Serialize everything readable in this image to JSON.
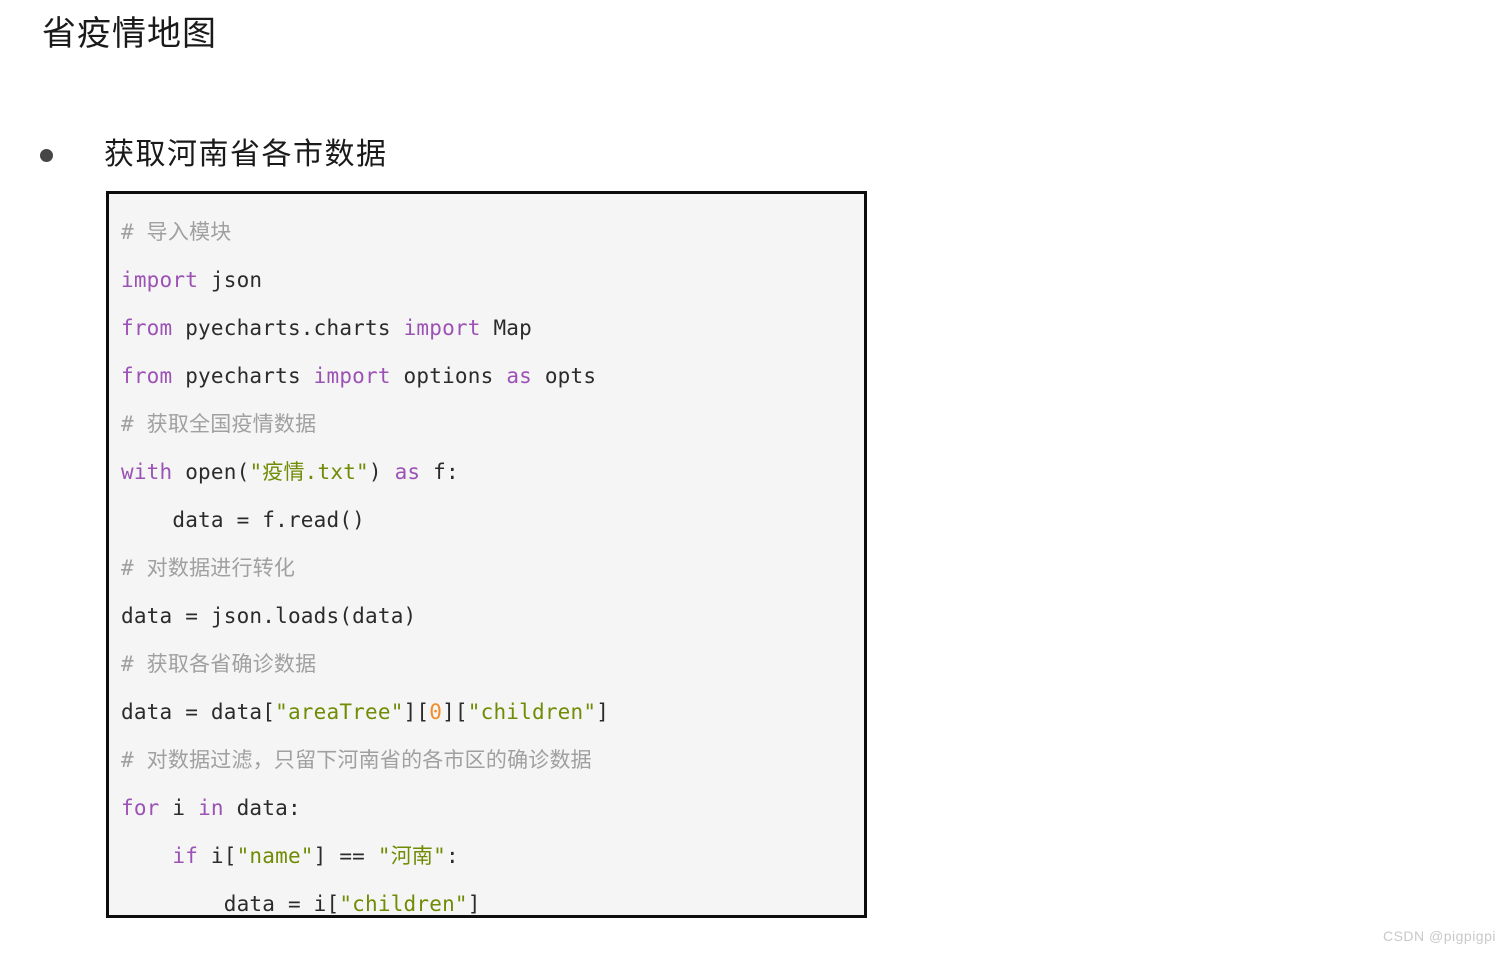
{
  "page": {
    "title": "省疫情地图",
    "background_color": "#ffffff"
  },
  "bullet": {
    "marker_icon": "filled-circle-bullet-icon",
    "marker_color": "#464646",
    "text": "获取河南省各市数据"
  },
  "code_block": {
    "background_color": "#f5f5f5",
    "border_color": "#0d0d0d",
    "language": "python",
    "syntax_colors": {
      "comment": "#a0a0a0",
      "keyword": "#9c52b5",
      "string": "#6f8c05",
      "number": "#f28c28",
      "plain": "#2b2b2b"
    },
    "lines": [
      {
        "index": 1,
        "text": "# 导入模块",
        "tokens": [
          {
            "t": "# 导入模块",
            "c": "comment"
          }
        ]
      },
      {
        "index": 2,
        "text": "import json",
        "tokens": [
          {
            "t": "import",
            "c": "kw"
          },
          {
            "t": " json",
            "c": "plain"
          }
        ]
      },
      {
        "index": 3,
        "text": "from pyecharts.charts import Map",
        "tokens": [
          {
            "t": "from",
            "c": "kw"
          },
          {
            "t": " pyecharts.charts ",
            "c": "plain"
          },
          {
            "t": "import",
            "c": "kw"
          },
          {
            "t": " Map",
            "c": "plain"
          }
        ]
      },
      {
        "index": 4,
        "text": "from pyecharts import options as opts",
        "tokens": [
          {
            "t": "from",
            "c": "kw"
          },
          {
            "t": " pyecharts ",
            "c": "plain"
          },
          {
            "t": "import",
            "c": "kw"
          },
          {
            "t": " options ",
            "c": "plain"
          },
          {
            "t": "as",
            "c": "kw"
          },
          {
            "t": " opts",
            "c": "plain"
          }
        ]
      },
      {
        "index": 5,
        "text": "# 获取全国疫情数据",
        "tokens": [
          {
            "t": "# 获取全国疫情数据",
            "c": "comment"
          }
        ]
      },
      {
        "index": 6,
        "text": "with open(\"疫情.txt\") as f:",
        "tokens": [
          {
            "t": "with",
            "c": "kw"
          },
          {
            "t": " open(",
            "c": "plain"
          },
          {
            "t": "\"疫情.txt\"",
            "c": "str"
          },
          {
            "t": ") ",
            "c": "plain"
          },
          {
            "t": "as",
            "c": "kw"
          },
          {
            "t": " f:",
            "c": "plain"
          }
        ]
      },
      {
        "index": 7,
        "text": "    data = f.read()",
        "tokens": [
          {
            "t": "    data = f.read()",
            "c": "plain"
          }
        ]
      },
      {
        "index": 8,
        "text": "# 对数据进行转化",
        "tokens": [
          {
            "t": "# 对数据进行转化",
            "c": "comment"
          }
        ]
      },
      {
        "index": 9,
        "text": "data = json.loads(data)",
        "tokens": [
          {
            "t": "data = json.loads(data)",
            "c": "plain"
          }
        ]
      },
      {
        "index": 10,
        "text": "# 获取各省确诊数据",
        "tokens": [
          {
            "t": "# 获取各省确诊数据",
            "c": "comment"
          }
        ]
      },
      {
        "index": 11,
        "text": "data = data[\"areaTree\"][0][\"children\"]",
        "tokens": [
          {
            "t": "data = data[",
            "c": "plain"
          },
          {
            "t": "\"areaTree\"",
            "c": "str"
          },
          {
            "t": "][",
            "c": "plain"
          },
          {
            "t": "0",
            "c": "num"
          },
          {
            "t": "][",
            "c": "plain"
          },
          {
            "t": "\"children\"",
            "c": "str"
          },
          {
            "t": "]",
            "c": "plain"
          }
        ]
      },
      {
        "index": 12,
        "text": "# 对数据过滤，只留下河南省的各市区的确诊数据",
        "tokens": [
          {
            "t": "# 对数据过滤，只留下河南省的各市区的确诊数据",
            "c": "comment"
          }
        ]
      },
      {
        "index": 13,
        "text": "for i in data:",
        "tokens": [
          {
            "t": "for",
            "c": "kw"
          },
          {
            "t": " i ",
            "c": "plain"
          },
          {
            "t": "in",
            "c": "kw"
          },
          {
            "t": " data:",
            "c": "plain"
          }
        ]
      },
      {
        "index": 14,
        "text": "    if i[\"name\"] == \"河南\":",
        "tokens": [
          {
            "t": "    ",
            "c": "plain"
          },
          {
            "t": "if",
            "c": "kw"
          },
          {
            "t": " i[",
            "c": "plain"
          },
          {
            "t": "\"name\"",
            "c": "str"
          },
          {
            "t": "] == ",
            "c": "plain"
          },
          {
            "t": "\"河南\"",
            "c": "str"
          },
          {
            "t": ":",
            "c": "plain"
          }
        ]
      },
      {
        "index": 15,
        "text": "        data = i[\"children\"]",
        "tokens": [
          {
            "t": "        data = i[",
            "c": "plain"
          },
          {
            "t": "\"children\"",
            "c": "str"
          },
          {
            "t": "]",
            "c": "plain"
          }
        ]
      }
    ]
  },
  "watermark": {
    "text": "CSDN @pigpigpi"
  }
}
